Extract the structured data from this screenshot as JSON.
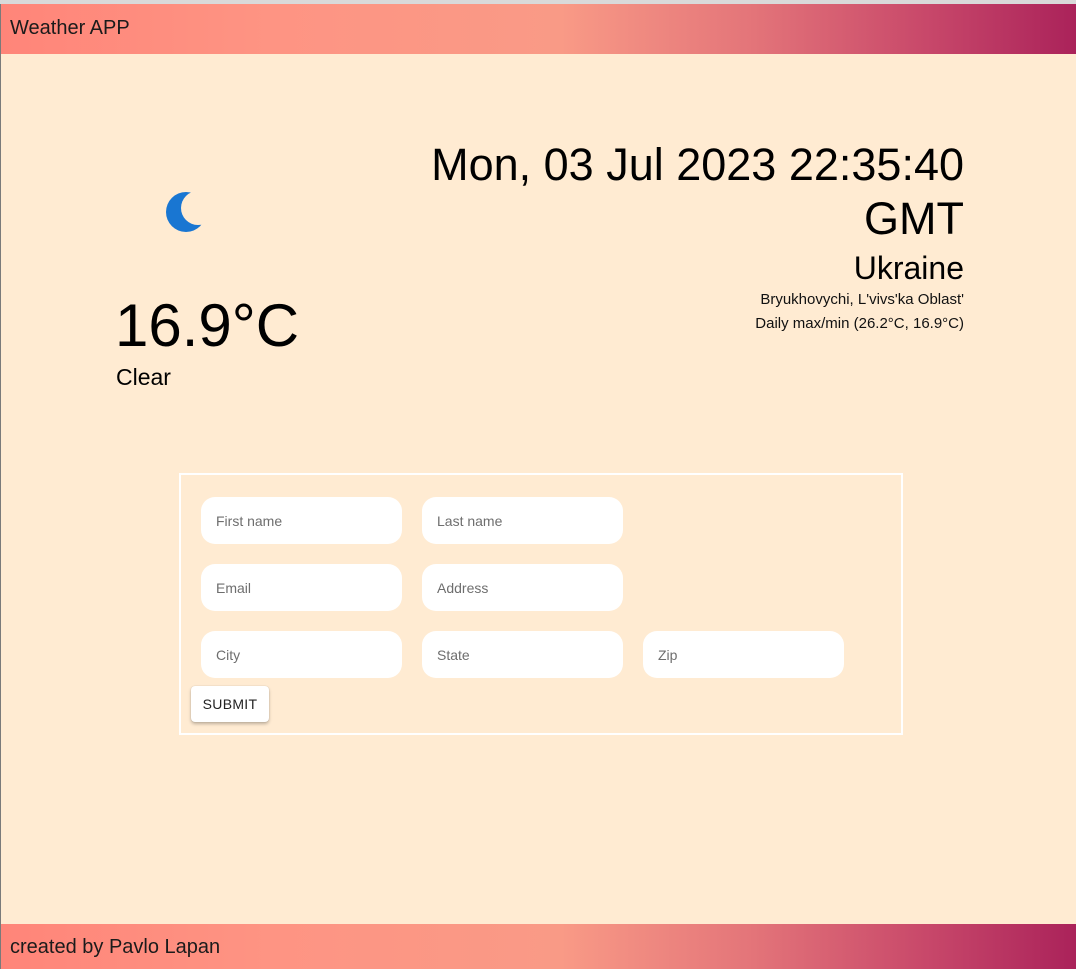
{
  "header": {
    "title": "Weather APP"
  },
  "weather": {
    "icon": "moon-icon",
    "temperature": "16.9°C",
    "condition": "Clear"
  },
  "info": {
    "datetime": "Mon, 03 Jul 2023 22:35:40 GMT",
    "country": "Ukraine",
    "locality": "Bryukhovychi, L'vivs'ka Oblast'",
    "daily_minmax": "Daily max/min (26.2°C, 16.9°C)"
  },
  "form": {
    "first_name_placeholder": "First name",
    "last_name_placeholder": "Last name",
    "email_placeholder": "Email",
    "address_placeholder": "Address",
    "city_placeholder": "City",
    "state_placeholder": "State",
    "zip_placeholder": "Zip",
    "submit_label": "SUBMIT"
  },
  "footer": {
    "text": "created by Pavlo Lapan"
  },
  "colors": {
    "background": "#ffebd2",
    "bar_gradient_start": "#ff8579",
    "bar_gradient_end": "#aa225a",
    "icon_blue": "#1976d2"
  }
}
